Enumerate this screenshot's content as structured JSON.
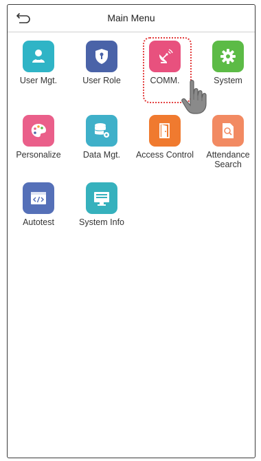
{
  "header": {
    "title": "Main Menu",
    "back_icon": "back-arrow-icon"
  },
  "menu": {
    "items": [
      {
        "label": "User Mgt.",
        "icon": "user-icon",
        "color": "#2fb4c6"
      },
      {
        "label": "User Role",
        "icon": "shield-icon",
        "color": "#4a63a8"
      },
      {
        "label": "COMM.",
        "icon": "satellite-dish-icon",
        "color": "#e8517e",
        "selected": true
      },
      {
        "label": "System",
        "icon": "gear-icon",
        "color": "#5cbb46"
      },
      {
        "label": "Personalize",
        "icon": "palette-icon",
        "color": "#ea5f8a"
      },
      {
        "label": "Data Mgt.",
        "icon": "database-icon",
        "color": "#3fb0c9"
      },
      {
        "label": "Access Control",
        "icon": "door-icon",
        "color": "#f07a2f"
      },
      {
        "label": "Attendance Search",
        "icon": "document-search-icon",
        "color": "#f28a62"
      },
      {
        "label": "Autotest",
        "icon": "code-window-icon",
        "color": "#5570b8"
      },
      {
        "label": "System Info",
        "icon": "monitor-icon",
        "color": "#36b1bd"
      }
    ]
  },
  "overlay": {
    "highlight_color": "#e33b3b",
    "pointer_icon": "hand-pointer-icon"
  }
}
